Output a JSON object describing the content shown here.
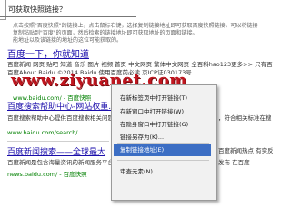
{
  "header": {
    "text": "可获取快照链接？"
  },
  "instructions": {
    "line1": "点击按照\"百度快照\"的链接上，点击鼠标右键，选择复制链接地址即可获取百度快照链接，可以将链接",
    "line2": "复制粘贴到\"百度\"的页面，然后检索的链接地址即可获取地址的页面和链接。",
    "line3": "能地址以及该链接的地址的这位可能获取的。"
  },
  "results": [
    {
      "title": "百度一下，你就知道",
      "snippet1": "百度新闻 网页 贴吧 知道 音乐 图片 视频 地图 文库 更多»",
      "snippet2": "百度About Baidu ©2014 Baidu 使用百度前必读 京ICP证030173号",
      "url": "www.baidu.com/ - 百度快照"
    },
    {
      "title": "百度搜索帮助中心-网站权重...",
      "snippet1": "百度搜索帮助中心提供百度搜索相关问题的解答。",
      "url": "www.baidu.com/search/..."
    },
    {
      "title": "百度新闻搜索——全球最大",
      "snippet1": "百度新闻是包含海量资讯的新闻服务平台",
      "url": "news.baidu.com/ - 百度快照"
    }
  ],
  "right_snippets": {
    "r1": "首页 中文网页 繁体中文网页 全百科hao123更多>> 只有百度推广|搜索风云榜|",
    "r2": "，符合相关标准在搜",
    "r3": "百度新闻热点 有实反映",
    "r4": "发布 在百度"
  },
  "watermark": "www.ziyuanet.com",
  "context_menu": {
    "items": [
      "在新标签页中打开链接(T)",
      "在新窗口中打开链接(W)",
      "在隐身窗口中打开链接(G)",
      "链接另存为(K)...",
      "复制链接地址(E)",
      "审查元素(N)"
    ],
    "highlighted_index": 4
  },
  "colors": {
    "link": "#1a0dab",
    "highlight": "#3c6ec4",
    "watermark": "#c0161f"
  }
}
